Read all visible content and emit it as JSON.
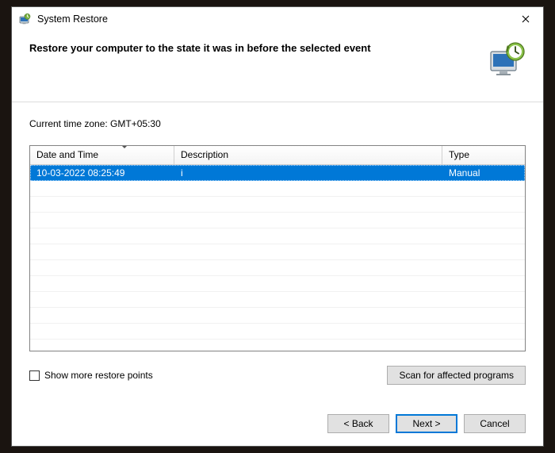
{
  "window": {
    "title": "System Restore"
  },
  "header": {
    "heading": "Restore your computer to the state it was in before the selected event"
  },
  "timezone_label_prefix": "Current time zone: ",
  "timezone_value": "GMT+05:30",
  "columns": {
    "date": "Date and Time",
    "desc": "Description",
    "type": "Type"
  },
  "rows": [
    {
      "date": "10-03-2022 08:25:49",
      "desc": "i",
      "type": "Manual"
    }
  ],
  "show_more_label": "Show more restore points",
  "scan_button": "Scan for affected programs",
  "nav": {
    "back": "< Back",
    "next": "Next >",
    "cancel": "Cancel"
  }
}
